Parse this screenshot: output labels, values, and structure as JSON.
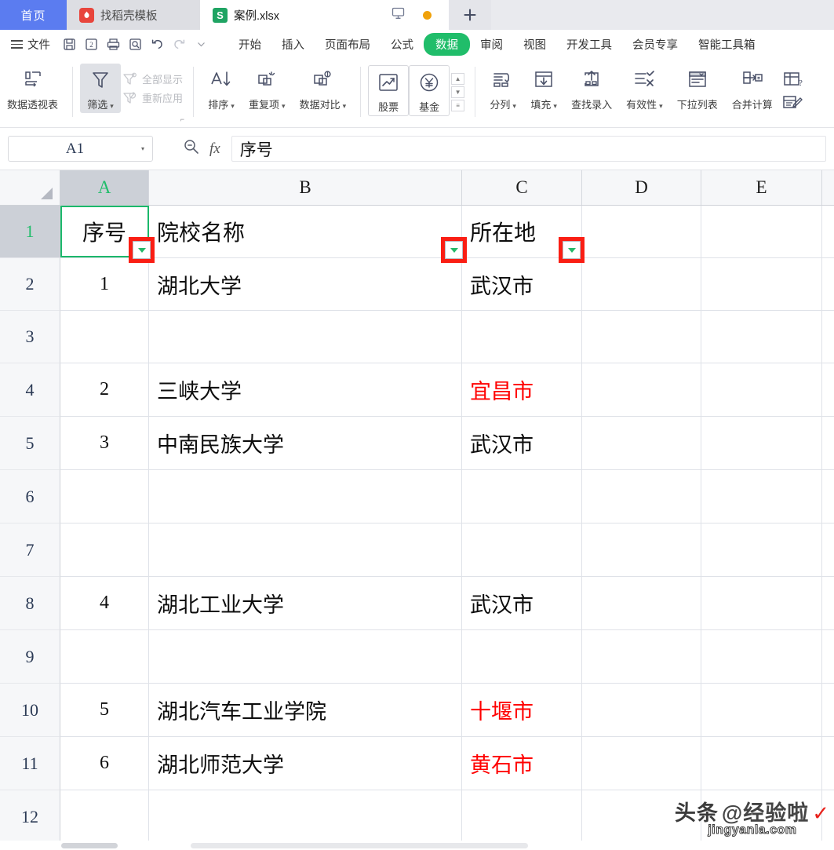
{
  "tabbar": {
    "home_label": "首页",
    "template_tab": "找稻壳模板",
    "file_tab": "案例.xlsx",
    "file_icon_letter": "S",
    "plus_label": "+",
    "monitor_icon": "monitor-icon",
    "dot_color": "#f0a10a"
  },
  "menubar": {
    "file_label": "文件",
    "quick_access": [
      "save-icon",
      "save-as-icon",
      "print-icon",
      "print-preview-icon",
      "undo-icon",
      "redo-icon",
      "customize-qat-icon"
    ],
    "items": [
      {
        "label": "开始",
        "active": false
      },
      {
        "label": "插入",
        "active": false
      },
      {
        "label": "页面布局",
        "active": false
      },
      {
        "label": "公式",
        "active": false
      },
      {
        "label": "数据",
        "active": true
      },
      {
        "label": "审阅",
        "active": false
      },
      {
        "label": "视图",
        "active": false
      },
      {
        "label": "开发工具",
        "active": false
      },
      {
        "label": "会员专享",
        "active": false
      },
      {
        "label": "智能工具箱",
        "active": false
      }
    ],
    "active_color": "#20bd6a"
  },
  "ribbon": {
    "pivot_table": "数据透视表",
    "filter": "筛选",
    "show_all": "全部显示",
    "reapply": "重新应用",
    "sort": "排序",
    "duplicates": "重复项",
    "data_compare": "数据对比",
    "stock": "股票",
    "fund": "基金",
    "split_columns": "分列",
    "fill": "填充",
    "lookup_entry": "查找录入",
    "validity": "有效性",
    "dropdown_list": "下拉列表",
    "merge_calc": "合并计算"
  },
  "formulabar": {
    "namebox_value": "A1",
    "formula_value": "序号",
    "fx_label": "fx",
    "zoom_icon": "zoom-search-icon",
    "namebox_caret": "chevron-down-icon"
  },
  "sheet": {
    "columns": [
      "A",
      "B",
      "C",
      "D",
      "E"
    ],
    "selected_column": "A",
    "selected_row": "1",
    "active_cell": "A1",
    "row_numbers": [
      "1",
      "2",
      "3",
      "4",
      "5",
      "6",
      "7",
      "8",
      "9",
      "10",
      "11",
      "12"
    ],
    "rows": [
      {
        "num": "1",
        "A": "序号",
        "B": "院校名称",
        "C": "所在地",
        "D": "",
        "E": "",
        "header": true,
        "c_red": false
      },
      {
        "num": "2",
        "A": "1",
        "B": "湖北大学",
        "C": "武汉市",
        "D": "",
        "E": "",
        "header": false,
        "c_red": false
      },
      {
        "num": "3",
        "A": "",
        "B": "",
        "C": "",
        "D": "",
        "E": "",
        "header": false,
        "c_red": false
      },
      {
        "num": "4",
        "A": "2",
        "B": "三峡大学",
        "C": "宜昌市",
        "D": "",
        "E": "",
        "header": false,
        "c_red": true
      },
      {
        "num": "5",
        "A": "3",
        "B": "中南民族大学",
        "C": "武汉市",
        "D": "",
        "E": "",
        "header": false,
        "c_red": false
      },
      {
        "num": "6",
        "A": "",
        "B": "",
        "C": "",
        "D": "",
        "E": "",
        "header": false,
        "c_red": false
      },
      {
        "num": "7",
        "A": "",
        "B": "",
        "C": "",
        "D": "",
        "E": "",
        "header": false,
        "c_red": false
      },
      {
        "num": "8",
        "A": "4",
        "B": "湖北工业大学",
        "C": "武汉市",
        "D": "",
        "E": "",
        "header": false,
        "c_red": false
      },
      {
        "num": "9",
        "A": "",
        "B": "",
        "C": "",
        "D": "",
        "E": "",
        "header": false,
        "c_red": false
      },
      {
        "num": "10",
        "A": "5",
        "B": "湖北汽车工业学院",
        "C": "十堰市",
        "D": "",
        "E": "",
        "header": false,
        "c_red": true
      },
      {
        "num": "11",
        "A": "6",
        "B": "湖北师范大学",
        "C": "黄石市",
        "D": "",
        "E": "",
        "header": false,
        "c_red": true
      },
      {
        "num": "12",
        "A": "",
        "B": "",
        "C": "",
        "D": "",
        "E": "",
        "header": false,
        "c_red": false
      }
    ],
    "filter_buttons": [
      {
        "name": "filter-dropdown-A1",
        "highlighted": true
      },
      {
        "name": "filter-dropdown-B1",
        "highlighted": true
      },
      {
        "name": "filter-dropdown-C1",
        "highlighted": true
      }
    ],
    "highlight_color": "#fa1e14",
    "selection_color": "#1bb86b",
    "red_text_color": "#ff0000"
  },
  "watermark": {
    "line1_a": "头条",
    "line1_b": "@经验啦",
    "line2": "jingyanla.com"
  }
}
